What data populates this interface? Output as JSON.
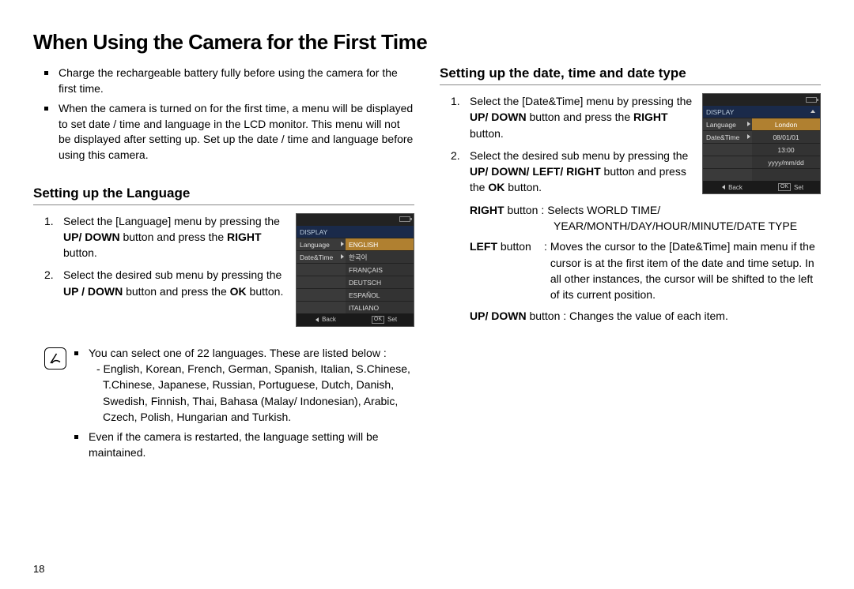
{
  "page_title": "When Using the Camera for the First Time",
  "page_number": "18",
  "intro_bullets": [
    "Charge the rechargeable battery fully before using the camera for the first time.",
    "When the camera is turned on for the first time, a menu will be displayed to set date / time and language in the LCD monitor. This menu will not be displayed after setting up. Set up the date / time and language before using this camera."
  ],
  "lang_section": {
    "title": "Setting up the Language",
    "steps": [
      {
        "pre": "Select the [Language] menu by pressing the ",
        "b": "UP/ DOWN",
        "mid": " button and press the ",
        "b2": "RIGHT",
        "post": " button."
      },
      {
        "pre": "Select the desired sub menu by pressing the ",
        "b": "UP / DOWN",
        "mid": " button and press the ",
        "b2": "OK",
        "post": " button."
      }
    ],
    "note1_lead": "You can select one of 22 languages. These are listed below :",
    "note1_langs": "- English, Korean, French, German, Spanish, Italian, S.Chinese, T.Chinese, Japanese, Russian, Portuguese, Dutch, Danish, Swedish, Finnish, Thai, Bahasa (Malay/ Indonesian), Arabic, Czech, Polish, Hungarian and Turkish.",
    "note2": "Even if the camera is restarted, the language setting will be maintained."
  },
  "date_section": {
    "title": "Setting up the date, time and date type",
    "steps": [
      {
        "pre": "Select the [Date&Time] menu by pressing the ",
        "b": "UP/ DOWN",
        "mid": " button and press the ",
        "b2": "RIGHT",
        "post": " button."
      },
      {
        "pre": "Select the desired sub menu by pressing the ",
        "b": "UP/ DOWN/ LEFT/ RIGHT",
        "mid": " button and press the ",
        "b2": "OK",
        "post": " button."
      }
    ],
    "right_btn": {
      "name": "RIGHT",
      "suffix": " button",
      "desc1": "Selects WORLD TIME/",
      "desc2": "YEAR/MONTH/DAY/HOUR/MINUTE/DATE TYPE"
    },
    "left_btn": {
      "name": "LEFT",
      "suffix": " button",
      "desc": "Moves the cursor to the [Date&Time] main menu if the cursor is at the first item of the date and time setup. In all other instances, the cursor will be shifted to the left of its current position."
    },
    "updown_btn": {
      "name": "UP/ DOWN",
      "suffix": " button : ",
      "desc": "Changes the value of each item."
    }
  },
  "lcd_lang": {
    "header": "DISPLAY",
    "left": [
      "Language",
      "Date&Time"
    ],
    "right": [
      "ENGLISH",
      "한국어",
      "FRANÇAIS",
      "DEUTSCH",
      "ESPAÑOL",
      "ITALIANO"
    ],
    "foot_back": "Back",
    "foot_ok": "OK",
    "foot_set": "Set"
  },
  "lcd_date": {
    "header": "DISPLAY",
    "left": [
      "Language",
      "Date&Time"
    ],
    "right_sel": "London",
    "right": [
      "08/01/01",
      "13:00",
      "yyyy/mm/dd"
    ],
    "foot_back": "Back",
    "foot_ok": "OK",
    "foot_set": "Set"
  }
}
